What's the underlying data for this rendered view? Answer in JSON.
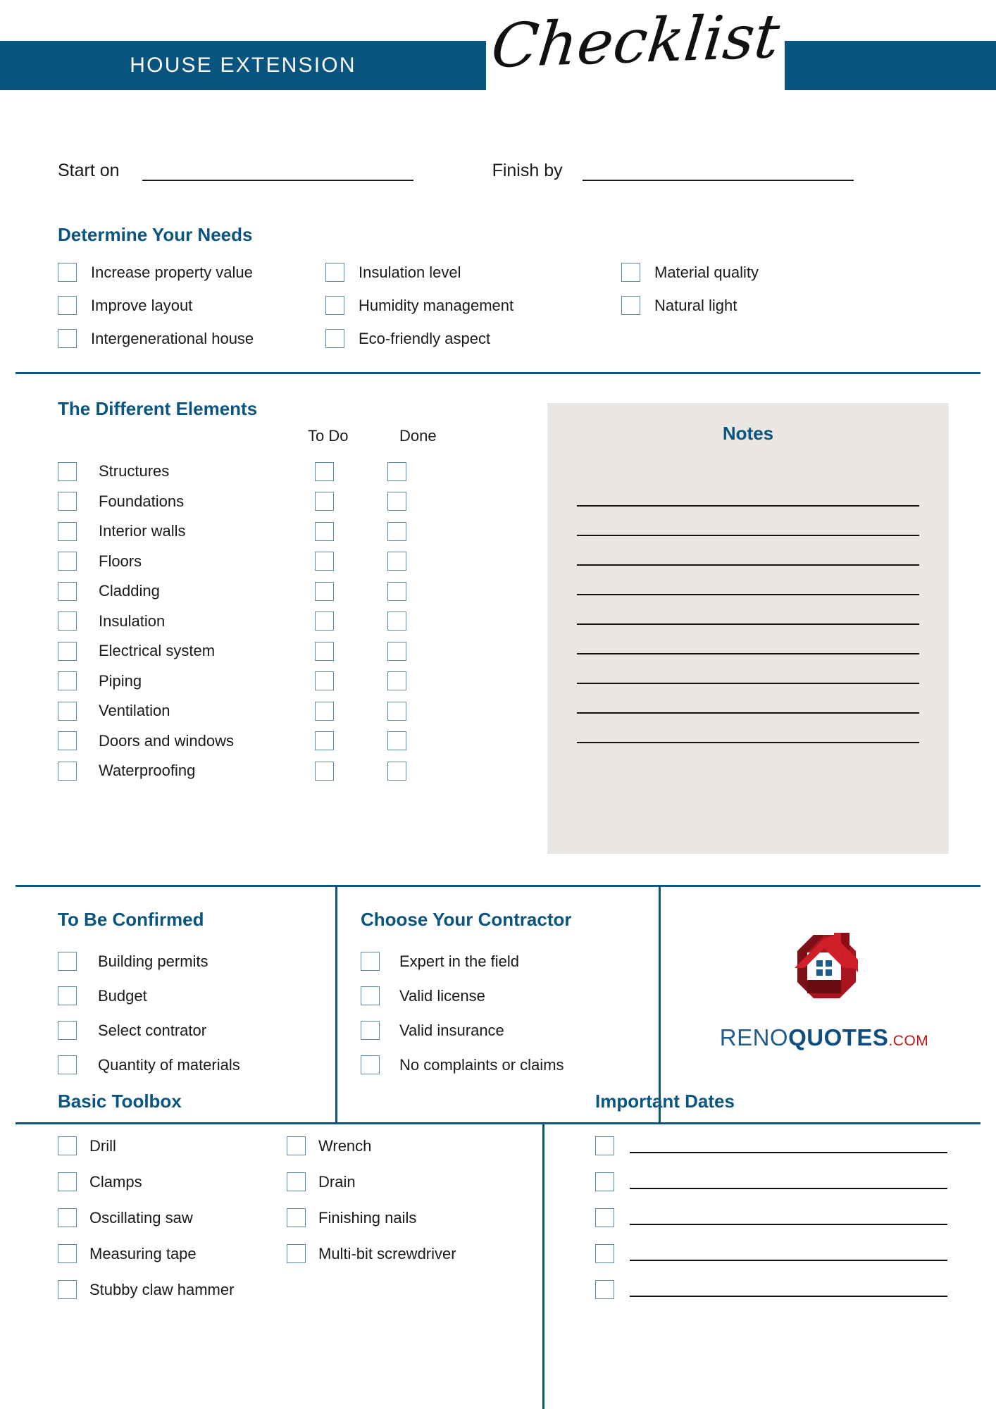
{
  "header": {
    "title": "HOUSE EXTENSION",
    "script_word": "Checklist",
    "accent_color": "#0a5480"
  },
  "dates": {
    "start_label": "Start on",
    "finish_label": "Finish by",
    "start_value": "",
    "finish_value": ""
  },
  "needs": {
    "title": "Determine Your Needs",
    "col1": [
      {
        "label": "Increase property value"
      },
      {
        "label": "Improve layout"
      },
      {
        "label": "Intergenerational house"
      }
    ],
    "col2": [
      {
        "label": "Insulation level"
      },
      {
        "label": "Humidity management"
      },
      {
        "label": "Eco-friendly aspect"
      }
    ],
    "col3": [
      {
        "label": "Material quality"
      },
      {
        "label": "Natural light"
      }
    ]
  },
  "elements": {
    "title": "The Different Elements",
    "col_todo": "To Do",
    "col_done": "Done",
    "rows": [
      {
        "label": "Structures"
      },
      {
        "label": "Foundations"
      },
      {
        "label": "Interior walls"
      },
      {
        "label": "Floors"
      },
      {
        "label": "Cladding"
      },
      {
        "label": "Insulation"
      },
      {
        "label": "Electrical system"
      },
      {
        "label": "Piping"
      },
      {
        "label": "Ventilation"
      },
      {
        "label": "Doors and windows"
      },
      {
        "label": "Waterproofing"
      }
    ]
  },
  "notes": {
    "title": "Notes",
    "line_count": 9,
    "background": "#e9e6e4"
  },
  "confirm": {
    "title": "To Be Confirmed",
    "items": [
      {
        "label": "Building permits"
      },
      {
        "label": "Budget"
      },
      {
        "label": "Select contrator"
      },
      {
        "label": "Quantity of materials"
      }
    ]
  },
  "contractor": {
    "title": "Choose Your Contractor",
    "items": [
      {
        "label": "Expert in the field"
      },
      {
        "label": "Valid license"
      },
      {
        "label": "Valid insurance"
      },
      {
        "label": "No complaints or claims"
      }
    ]
  },
  "logo": {
    "reno": "RENO",
    "quotes": "QUOTES",
    "dotcom": ".COM",
    "roof_color": "#c8202a",
    "roof_dark": "#8c0d15",
    "window_color": "#1f5c8b"
  },
  "toolbox": {
    "title": "Basic Toolbox",
    "left": [
      {
        "label": "Drill"
      },
      {
        "label": "Clamps"
      },
      {
        "label": "Oscillating saw"
      },
      {
        "label": "Measuring tape"
      },
      {
        "label": "Stubby claw hammer"
      }
    ],
    "right": [
      {
        "label": "Wrench"
      },
      {
        "label": "Drain"
      },
      {
        "label": "Finishing nails"
      },
      {
        "label": "Multi-bit screwdriver"
      }
    ]
  },
  "important_dates": {
    "title": "Important Dates",
    "row_count": 5,
    "rows": [
      {
        "value": ""
      },
      {
        "value": ""
      },
      {
        "value": ""
      },
      {
        "value": ""
      },
      {
        "value": ""
      }
    ]
  }
}
